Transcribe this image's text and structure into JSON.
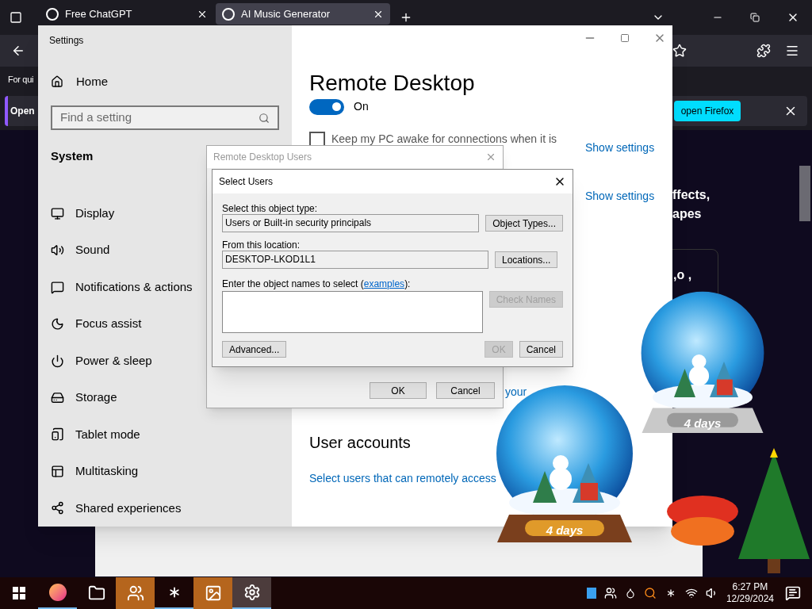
{
  "browser": {
    "tabs": [
      {
        "label": "Free ChatGPT",
        "selected": false
      },
      {
        "label": "AI Music Generator",
        "selected": true
      }
    ],
    "sidebar_text": "For qui",
    "banner_text": "Open",
    "banner_button": "open Firefox",
    "page_lines": [
      "ffects,",
      "apes"
    ],
    "card_text": ",o ,"
  },
  "settings": {
    "title": "Settings",
    "home": "Home",
    "search_placeholder": "Find a setting",
    "section": "System",
    "nav": [
      {
        "label": "Display",
        "kind": "display"
      },
      {
        "label": "Sound",
        "kind": "sound"
      },
      {
        "label": "Notifications & actions",
        "kind": "notifications"
      },
      {
        "label": "Focus assist",
        "kind": "focus"
      },
      {
        "label": "Power & sleep",
        "kind": "power"
      },
      {
        "label": "Storage",
        "kind": "storage"
      },
      {
        "label": "Tablet mode",
        "kind": "tablet"
      },
      {
        "label": "Multitasking",
        "kind": "multitasking"
      },
      {
        "label": "Shared experiences",
        "kind": "shared"
      }
    ],
    "heading": "Remote Desktop",
    "toggle": {
      "on": true,
      "label": "On"
    },
    "keep_awake": {
      "label": "Keep my PC awake for connections when it is",
      "checked": false
    },
    "show_settings": [
      "Show settings",
      "Show settings"
    ],
    "question_fragment": "your",
    "user_accounts": {
      "heading": "User accounts",
      "link": "Select users that can remotely access"
    }
  },
  "rdu_dialog": {
    "title": "Remote Desktop Users",
    "ok": "OK",
    "cancel": "Cancel"
  },
  "select_users": {
    "title": "Select Users",
    "object_type_label": "Select this object type:",
    "object_type": "Users or Built-in security principals",
    "object_types_button": "Object Types...",
    "location_label": "From this location:",
    "location": "DESKTOP-LKOD1L1",
    "locations_button": "Locations...",
    "names_label": "Enter the object names to select (",
    "names_link": "examples",
    "names_label_end": "):",
    "check_names": {
      "label": "Check Names",
      "disabled": true
    },
    "advanced": "Advanced...",
    "ok": {
      "label": "OK",
      "disabled": true
    },
    "cancel": "Cancel"
  },
  "globes": [
    {
      "label": "4 days"
    },
    {
      "label": "4 days"
    }
  ],
  "taskbar": {
    "apps": [
      {
        "kind": "firefox",
        "running": true,
        "attention": false,
        "selected": false
      },
      {
        "kind": "folder",
        "running": false,
        "attention": false,
        "selected": false
      },
      {
        "kind": "people",
        "running": false,
        "attention": true,
        "selected": false
      },
      {
        "kind": "asterisk",
        "running": true,
        "attention": false,
        "selected": false
      },
      {
        "kind": "picture",
        "running": false,
        "attention": true,
        "selected": false
      },
      {
        "kind": "gear",
        "running": true,
        "attention": false,
        "selected": true
      }
    ],
    "time": "6:27 PM",
    "date": "12/29/2024"
  }
}
